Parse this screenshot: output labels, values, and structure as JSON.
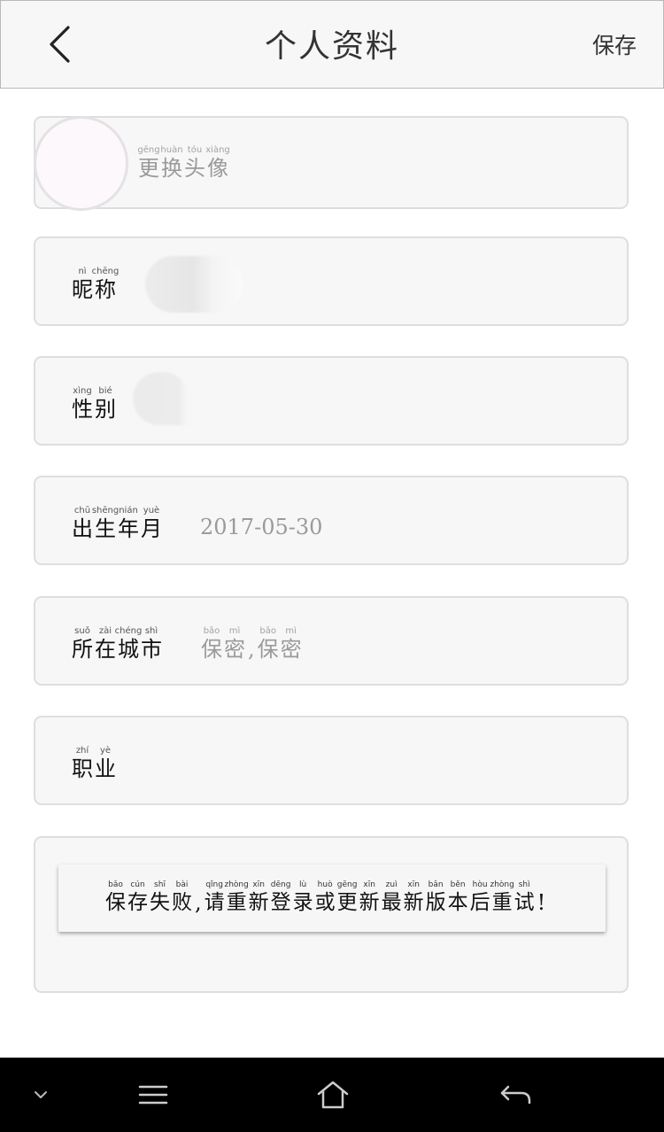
{
  "header": {
    "title": "个人资料",
    "save_label": "保存"
  },
  "avatar_row": {
    "label": [
      {
        "py": "gēng",
        "ch": "更"
      },
      {
        "py": "huàn",
        "ch": "换"
      },
      {
        "py": "tóu",
        "ch": "头"
      },
      {
        "py": "xiàng",
        "ch": "像"
      }
    ]
  },
  "nickname_row": {
    "label": [
      {
        "py": "nì",
        "ch": "昵"
      },
      {
        "py": "chēng",
        "ch": "称"
      }
    ]
  },
  "gender_row": {
    "label": [
      {
        "py": "xìng",
        "ch": "性"
      },
      {
        "py": "bié",
        "ch": "别"
      }
    ]
  },
  "birth_row": {
    "label": [
      {
        "py": "chū",
        "ch": "出"
      },
      {
        "py": "shēng",
        "ch": "生"
      },
      {
        "py": "nián",
        "ch": "年"
      },
      {
        "py": "yuè",
        "ch": "月"
      }
    ],
    "value": "2017-05-30"
  },
  "city_row": {
    "label": [
      {
        "py": "suǒ",
        "ch": "所"
      },
      {
        "py": "zài",
        "ch": "在"
      },
      {
        "py": "chéng",
        "ch": "城"
      },
      {
        "py": "shì",
        "ch": "市"
      }
    ],
    "value_part1": [
      {
        "py": "bǎo",
        "ch": "保"
      },
      {
        "py": "mì",
        "ch": "密"
      }
    ],
    "separator": ",",
    "value_part2": [
      {
        "py": "bǎo",
        "ch": "保"
      },
      {
        "py": "mì",
        "ch": "密"
      }
    ]
  },
  "job_row": {
    "label": [
      {
        "py": "zhí",
        "ch": "职"
      },
      {
        "py": "yè",
        "ch": "业"
      }
    ]
  },
  "error_toast": {
    "part1": [
      {
        "py": "bǎo",
        "ch": "保"
      },
      {
        "py": "cún",
        "ch": "存"
      },
      {
        "py": "shī",
        "ch": "失"
      },
      {
        "py": "bài",
        "ch": "败"
      }
    ],
    "separator": ",",
    "part2": [
      {
        "py": "qǐng",
        "ch": "请"
      },
      {
        "py": "zhòng",
        "ch": "重"
      },
      {
        "py": "xīn",
        "ch": "新"
      },
      {
        "py": "dēng",
        "ch": "登"
      },
      {
        "py": "lù",
        "ch": "录"
      },
      {
        "py": "huò",
        "ch": "或"
      },
      {
        "py": "gēng",
        "ch": "更"
      },
      {
        "py": "xīn",
        "ch": "新"
      },
      {
        "py": "zuì",
        "ch": "最"
      },
      {
        "py": "xīn",
        "ch": "新"
      },
      {
        "py": "bǎn",
        "ch": "版"
      },
      {
        "py": "běn",
        "ch": "本"
      },
      {
        "py": "hòu",
        "ch": "后"
      },
      {
        "py": "zhòng",
        "ch": "重"
      },
      {
        "py": "shì",
        "ch": "试"
      }
    ],
    "end_punct": "!"
  },
  "navbar": {
    "icons": [
      "chevron-down-icon",
      "menu-icon",
      "home-icon",
      "back-arrow-icon"
    ]
  },
  "colors": {
    "header_bg": "#f7f7f7",
    "row_bg": "#f7f7f7",
    "row_border": "#dedede",
    "value_grey": "#9a9a9a",
    "navbar_bg": "#000000"
  }
}
